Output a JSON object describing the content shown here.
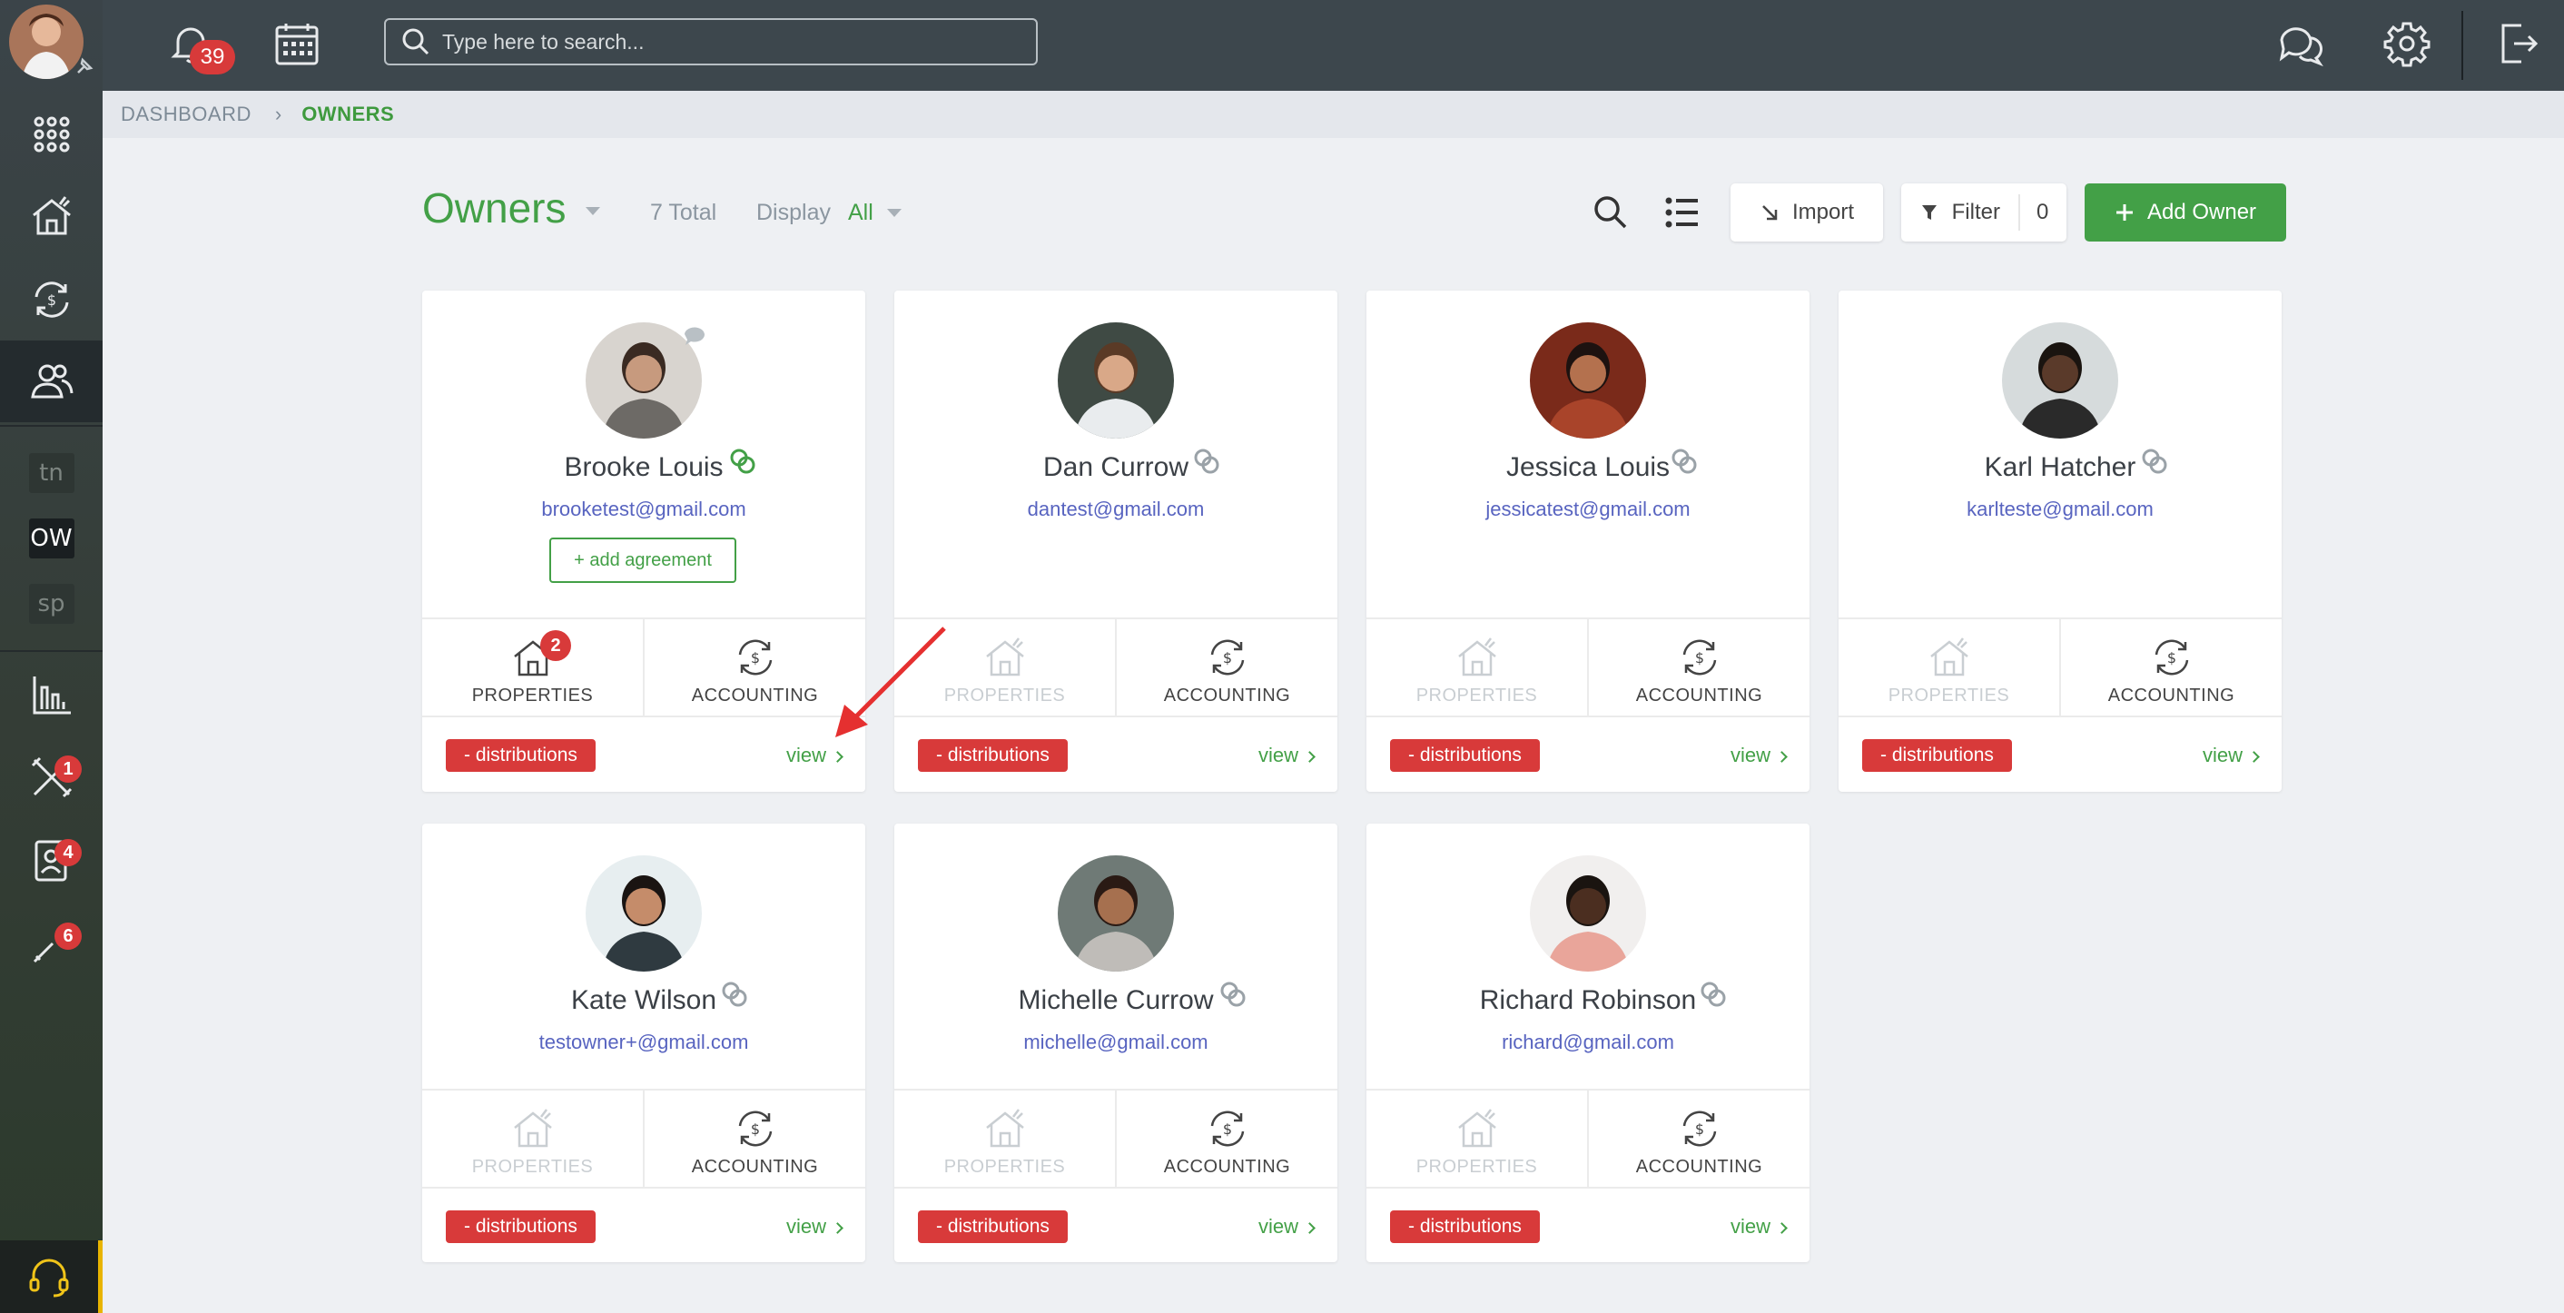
{
  "topbar": {
    "notification_count": "39",
    "search_placeholder": "Type here to search..."
  },
  "sidebar": {
    "items": [
      {
        "name": "apps"
      },
      {
        "name": "properties"
      },
      {
        "name": "accounting"
      },
      {
        "name": "owners",
        "active": true
      },
      {
        "name": "tn",
        "text": "tn"
      },
      {
        "name": "ow",
        "text": "OW"
      },
      {
        "name": "sp",
        "text": "sp"
      },
      {
        "name": "reports"
      },
      {
        "name": "maintenance",
        "badge": "1"
      },
      {
        "name": "tenants",
        "badge": "4"
      },
      {
        "name": "services",
        "badge": "6"
      }
    ]
  },
  "breadcrumb": {
    "home": "DASHBOARD",
    "current": "OWNERS"
  },
  "header": {
    "title": "Owners",
    "total": "7 Total",
    "display_label": "Display",
    "display_value": "All",
    "import_label": "Import",
    "filter_label": "Filter",
    "filter_count": "0",
    "add_label": "Add Owner"
  },
  "labels": {
    "properties": "PROPERTIES",
    "accounting": "ACCOUNTING",
    "distributions": "- distributions",
    "view": "view",
    "add_agreement": "+ add agreement"
  },
  "owners": [
    {
      "name": "Brooke Louis",
      "email": "brooketest@gmail.com",
      "properties_count": "2",
      "linked": true,
      "has_agreement_button": true
    },
    {
      "name": "Dan Currow",
      "email": "dantest@gmail.com"
    },
    {
      "name": "Jessica Louis",
      "email": "jessicatest@gmail.com"
    },
    {
      "name": "Karl Hatcher",
      "email": "karlteste@gmail.com"
    },
    {
      "name": "Kate Wilson",
      "email": "testowner+@gmail.com"
    },
    {
      "name": "Michelle Currow",
      "email": "michelle@gmail.com"
    },
    {
      "name": "Richard Robinson",
      "email": "richard@gmail.com"
    }
  ],
  "colors": {
    "brand_green": "#43a047",
    "badge_red": "#d83a3a",
    "email_blue": "#5864c0",
    "topbar": "#3d474d"
  }
}
